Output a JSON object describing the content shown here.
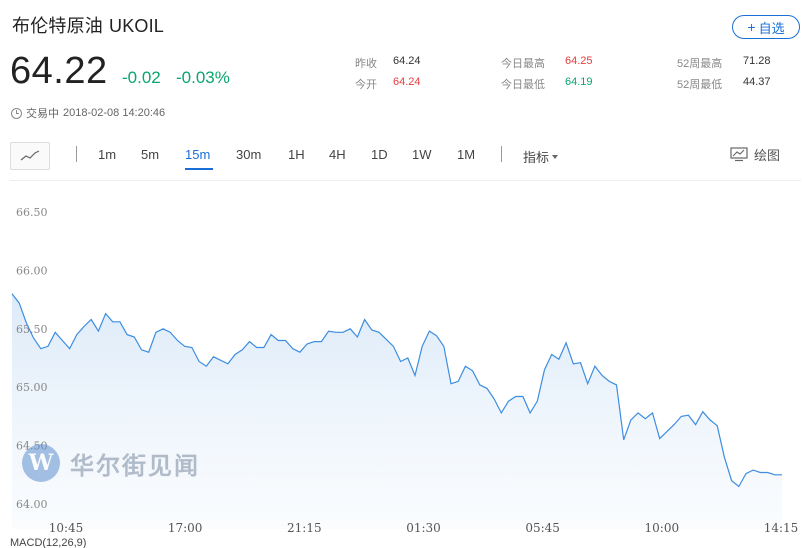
{
  "header": {
    "name": "布伦特原油",
    "code": "UKOIL",
    "follow_label": "自选",
    "follow_plus": "+"
  },
  "quote": {
    "price": "64.22",
    "change": "-0.02",
    "change_pct": "-0.03%",
    "status": "交易中",
    "timestamp": "2018-02-08 14:20:46"
  },
  "stats": {
    "prev_close_label": "昨收",
    "prev_close": "64.24",
    "open_label": "今开",
    "open": "64.24",
    "high_label": "今日最高",
    "high": "64.25",
    "low_label": "今日最低",
    "low": "64.19",
    "w52_high_label": "52周最高",
    "w52_high": "71.28",
    "w52_low_label": "52周最低",
    "w52_low": "44.37"
  },
  "toolbar": {
    "periods": [
      "1m",
      "5m",
      "15m",
      "30m",
      "1H",
      "4H",
      "1D",
      "1W",
      "1M"
    ],
    "active_period": "15m",
    "indicator_label": "指标",
    "draw_label": "绘图"
  },
  "watermark": {
    "logo_letter": "W",
    "text": "华尔街见闻"
  },
  "macd_label": "MACD(12,26,9)",
  "colors": {
    "accent": "#1a6fd6",
    "up": "#e53e3e",
    "down": "#0aa66e",
    "line": "#3d8de0",
    "area": "#eaf3fc"
  },
  "icons": {
    "chart_type": "line-chart-icon",
    "draw": "drawing-board-icon",
    "clock": "clock-icon"
  },
  "chart_data": {
    "type": "area",
    "ylim": [
      64.0,
      66.5
    ],
    "yticks": [
      "66.50",
      "66.00",
      "65.50",
      "65.00",
      "64.50",
      "64.00"
    ],
    "xticks": [
      "10:45",
      "17:00",
      "21:15",
      "01:30",
      "05:45",
      "10:00",
      "14:15"
    ],
    "grid": false,
    "values": [
      65.8,
      65.72,
      65.55,
      65.42,
      65.33,
      65.35,
      65.47,
      65.4,
      65.33,
      65.45,
      65.52,
      65.58,
      65.48,
      65.63,
      65.56,
      65.56,
      65.45,
      65.43,
      65.32,
      65.3,
      65.47,
      65.5,
      65.47,
      65.4,
      65.35,
      65.34,
      65.22,
      65.18,
      65.26,
      65.23,
      65.2,
      65.28,
      65.32,
      65.39,
      65.34,
      65.34,
      65.45,
      65.4,
      65.4,
      65.33,
      65.3,
      65.37,
      65.39,
      65.39,
      65.48,
      65.47,
      65.47,
      65.5,
      65.43,
      65.58,
      65.49,
      65.47,
      65.41,
      65.35,
      65.22,
      65.25,
      65.1,
      65.35,
      65.48,
      65.44,
      65.35,
      65.03,
      65.05,
      65.18,
      65.14,
      65.02,
      64.99,
      64.9,
      64.78,
      64.88,
      64.92,
      64.92,
      64.78,
      64.88,
      65.15,
      65.28,
      65.24,
      65.38,
      65.2,
      65.21,
      65.03,
      65.18,
      65.1,
      65.05,
      65.02,
      64.55,
      64.72,
      64.78,
      64.73,
      64.78,
      64.56,
      64.62,
      64.68,
      64.75,
      64.76,
      64.68,
      64.79,
      64.72,
      64.67,
      64.4,
      64.2,
      64.15,
      64.26,
      64.29,
      64.27,
      64.27,
      64.25,
      64.25
    ]
  }
}
